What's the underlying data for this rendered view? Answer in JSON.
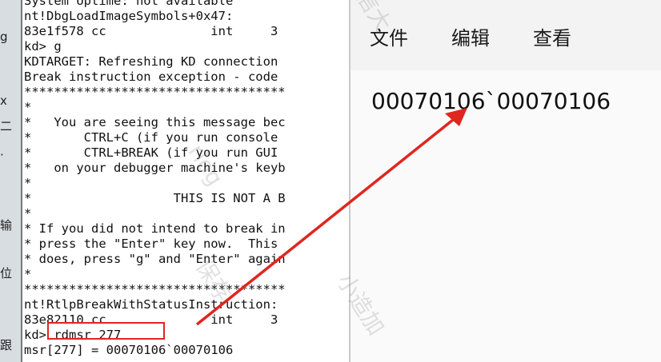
{
  "left_strip": {
    "chars": [
      "g",
      "x",
      "二",
      "·",
      "输",
      "位",
      "跟"
    ]
  },
  "console": {
    "lines": [
      "System Uptime: not available",
      "nt!DbgLoadImageSymbols+0x47:",
      "83e1f578 cc              int     3",
      "kd> g",
      "KDTARGET: Refreshing KD connection",
      "Break instruction exception - code",
      "***********************************",
      "*",
      "*   You are seeing this message bec",
      "*       CTRL+C (if you run console",
      "*       CTRL+BREAK (if you run GUI",
      "*   on your debugger machine's keyb",
      "*",
      "*                   THIS IS NOT A B",
      "*",
      "* If you did not intend to break in",
      "* press the \"Enter\" key now.  This",
      "* does, press \"g\" and \"Enter\" again",
      "*",
      "***********************************",
      "nt!RtlpBreakWithStatusInstruction:",
      "83e82110 cc              int     3",
      "kd> rdmsr 277",
      "msr[277] = 00070106`00070106"
    ]
  },
  "editor": {
    "menu": [
      "文件",
      "编辑",
      "查看"
    ],
    "content": "00070106`00070106"
  },
  "watermarks": [
    "信大",
    "rlog",
    "保存",
    "小造加"
  ],
  "colors": {
    "highlight": "#e0261f",
    "arrow": "#e0261f"
  }
}
